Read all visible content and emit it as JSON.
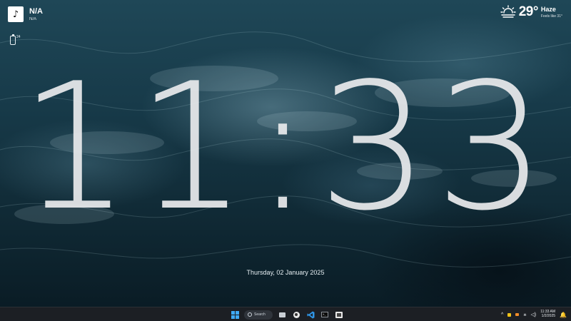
{
  "media": {
    "title": "N/A",
    "artist": "N/A",
    "art_icon": "music-note-icon"
  },
  "battery": {
    "icon": "battery-icon",
    "level_text": "24"
  },
  "weather": {
    "temperature": "29°",
    "condition": "Haze",
    "feels_like": "Feels like 31°",
    "icon": "sun-haze-icon"
  },
  "clock": {
    "time": "11:33"
  },
  "date": {
    "text": "Thursday, 02 January 2025"
  },
  "taskbar": {
    "start_icon": "windows-logo-icon",
    "search_label": "Search",
    "apps": [
      "task-view-icon",
      "obs-icon",
      "vscode-icon",
      "terminal-icon",
      "file-explorer-icon"
    ],
    "tray": {
      "chevron": "^",
      "network": "⚹",
      "volume": "◁)",
      "clock_time": "11:33 AM",
      "clock_date": "1/2/2025",
      "bell": "🔔"
    }
  },
  "colors": {
    "accent_blue": "#3fa9f5",
    "taskbar_bg": "#1c1f24",
    "clock_text": "#e8eaec"
  }
}
